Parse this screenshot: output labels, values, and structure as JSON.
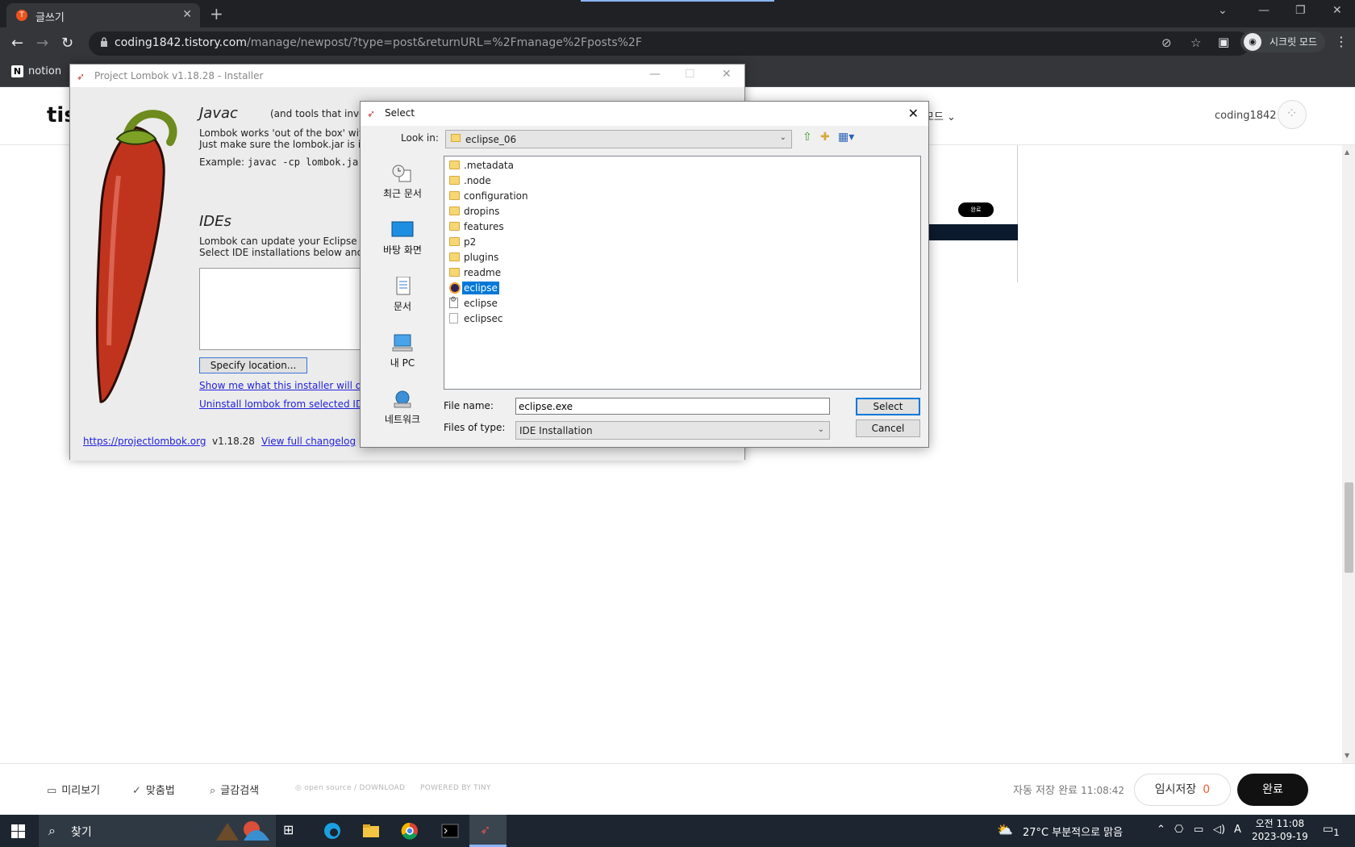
{
  "browser": {
    "tab_title": "글쓰기",
    "tab_favicon": "T",
    "url_host": "coding1842.tistory.com",
    "url_path": "/manage/newpost/?type=post&returnURL=%2Fmanage%2Fposts%2F",
    "incognito_label": "시크릿 모드",
    "bookmark_notion": "notion"
  },
  "tistory": {
    "logo": "tis",
    "mode_label": "모드",
    "username": "coding1842",
    "thumb_badge": "완료",
    "bottom": {
      "preview": "미리보기",
      "spellcheck": "맞춤법",
      "search": "글감검색",
      "opensource": "open source / DOWNLOAD",
      "powered": "POWERED BY TINY",
      "autosave_label": "자동 저장 완료",
      "autosave_time": "11:08:42",
      "temp_save": "임시저장",
      "temp_count": "0",
      "done": "완료"
    }
  },
  "lombok": {
    "window_title": "Project Lombok v1.18.28 - Installer",
    "javac_title": "Javac",
    "javac_note": "(and tools that invo",
    "javac_line1": "Lombok works 'out of the box' with",
    "javac_line2": "Just make sure the lombok.jar is in",
    "example_label": "Example:",
    "example_code": "javac -cp lombok.jar",
    "ides_title": "IDEs",
    "ides_line1": "Lombok can update your Eclipse or",
    "ides_line2": "Select IDE installations below and h",
    "specify_btn": "Specify location...",
    "show_link": "Show me what this installer will do",
    "uninstall_link": "Uninstall lombok from selected IDE",
    "site_link": "https://projectlombok.org",
    "version": "v1.18.28",
    "changelog_link": "View full changelog"
  },
  "dialog": {
    "title": "Select",
    "look_in_label": "Look in:",
    "look_in_value": "eclipse_06",
    "places": [
      {
        "label": "최근 문서",
        "icon": "recent-icon"
      },
      {
        "label": "바탕 화면",
        "icon": "desktop-icon"
      },
      {
        "label": "문서",
        "icon": "documents-icon"
      },
      {
        "label": "내 PC",
        "icon": "pc-icon"
      },
      {
        "label": "네트워크",
        "icon": "network-icon"
      }
    ],
    "files": [
      {
        "name": ".metadata",
        "type": "folder"
      },
      {
        "name": ".node",
        "type": "folder"
      },
      {
        "name": "configuration",
        "type": "folder"
      },
      {
        "name": "dropins",
        "type": "folder"
      },
      {
        "name": "features",
        "type": "folder"
      },
      {
        "name": "p2",
        "type": "folder"
      },
      {
        "name": "plugins",
        "type": "folder"
      },
      {
        "name": "readme",
        "type": "folder"
      },
      {
        "name": "eclipse",
        "type": "exe",
        "selected": true
      },
      {
        "name": "eclipse",
        "type": "ini"
      },
      {
        "name": "eclipsec",
        "type": "file"
      }
    ],
    "file_name_label": "File name:",
    "file_name_value": "eclipse.exe",
    "files_of_type_label": "Files of type:",
    "files_of_type_value": "IDE Installation",
    "select_btn": "Select",
    "cancel_btn": "Cancel"
  },
  "taskbar": {
    "search_placeholder": "찾기",
    "weather": "27°C  부분적으로 맑음",
    "ime": "A",
    "time": "오전 11:08",
    "date": "2023-09-19",
    "notif_count": "1"
  }
}
